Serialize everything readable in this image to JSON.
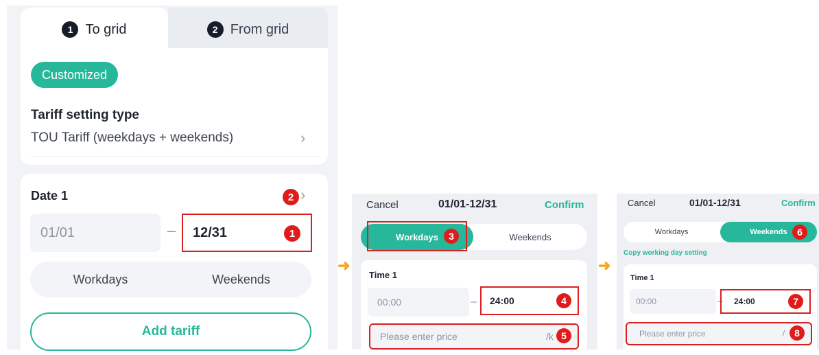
{
  "colors": {
    "accent": "#27b79a",
    "annotation": "#e01b1b",
    "arrow": "#f5a623"
  },
  "panel1": {
    "tabs": [
      {
        "number": "1",
        "label": "To grid"
      },
      {
        "number": "2",
        "label": "From grid"
      }
    ],
    "chip_label": "Customized",
    "setting_title": "Tariff setting type",
    "setting_value": "TOU Tariff (weekdays + weekends)",
    "date_title": "Date 1",
    "date_start": "01/01",
    "date_end": "12/31",
    "segments": [
      "Workdays",
      "Weekends"
    ],
    "add_button": "Add tariff",
    "markers": [
      "1",
      "2"
    ]
  },
  "panel2": {
    "cancel": "Cancel",
    "title": "01/01-12/31",
    "confirm": "Confirm",
    "segments": [
      "Workdays",
      "Weekends"
    ],
    "time_title": "Time 1",
    "time_start": "00:00",
    "time_end": "24:00",
    "price_placeholder": "Please enter price",
    "unit": "/k",
    "markers": [
      "3",
      "4",
      "5"
    ]
  },
  "panel3": {
    "cancel": "Cancel",
    "title": "01/01-12/31",
    "confirm": "Confirm",
    "segments": [
      "Workdays",
      "Weekends"
    ],
    "copy_link": "Copy working day setting",
    "time_title": "Time 1",
    "time_start": "00:00",
    "time_end": "24:00",
    "price_placeholder": "Please enter price",
    "unit": "/",
    "markers": [
      "6",
      "7",
      "8"
    ]
  },
  "arrows": [
    "➜",
    "➜"
  ]
}
